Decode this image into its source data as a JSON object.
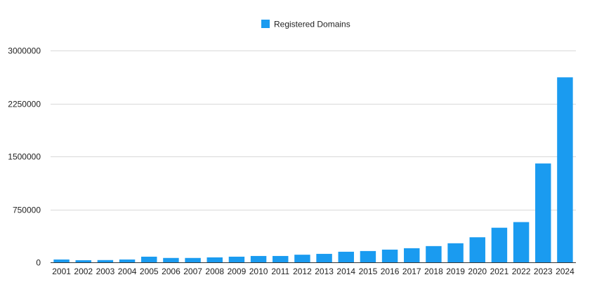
{
  "chart_data": {
    "type": "bar",
    "title": "",
    "xlabel": "",
    "ylabel": "",
    "categories": [
      "2001",
      "2002",
      "2003",
      "2004",
      "2005",
      "2006",
      "2007",
      "2008",
      "2009",
      "2010",
      "2011",
      "2012",
      "2013",
      "2014",
      "2015",
      "2016",
      "2017",
      "2018",
      "2019",
      "2020",
      "2021",
      "2022",
      "2023",
      "2024"
    ],
    "series": [
      {
        "name": "Registered Domains",
        "color": "#1a9bf0",
        "values": [
          40000,
          30000,
          32000,
          40000,
          80000,
          62000,
          62000,
          70000,
          80000,
          90000,
          90000,
          108000,
          120000,
          150000,
          160000,
          180000,
          200000,
          230000,
          270000,
          355000,
          490000,
          570000,
          1400000,
          2620000
        ]
      }
    ],
    "ylim": [
      0,
      3000000
    ],
    "yticks": [
      0,
      750000,
      1500000,
      2250000,
      3000000
    ],
    "ytick_labels": [
      "0",
      "750000",
      "1500000",
      "2250000",
      "3000000"
    ],
    "grid": true,
    "grid_color": "#d9d9d9",
    "legend_position": "top-center"
  }
}
